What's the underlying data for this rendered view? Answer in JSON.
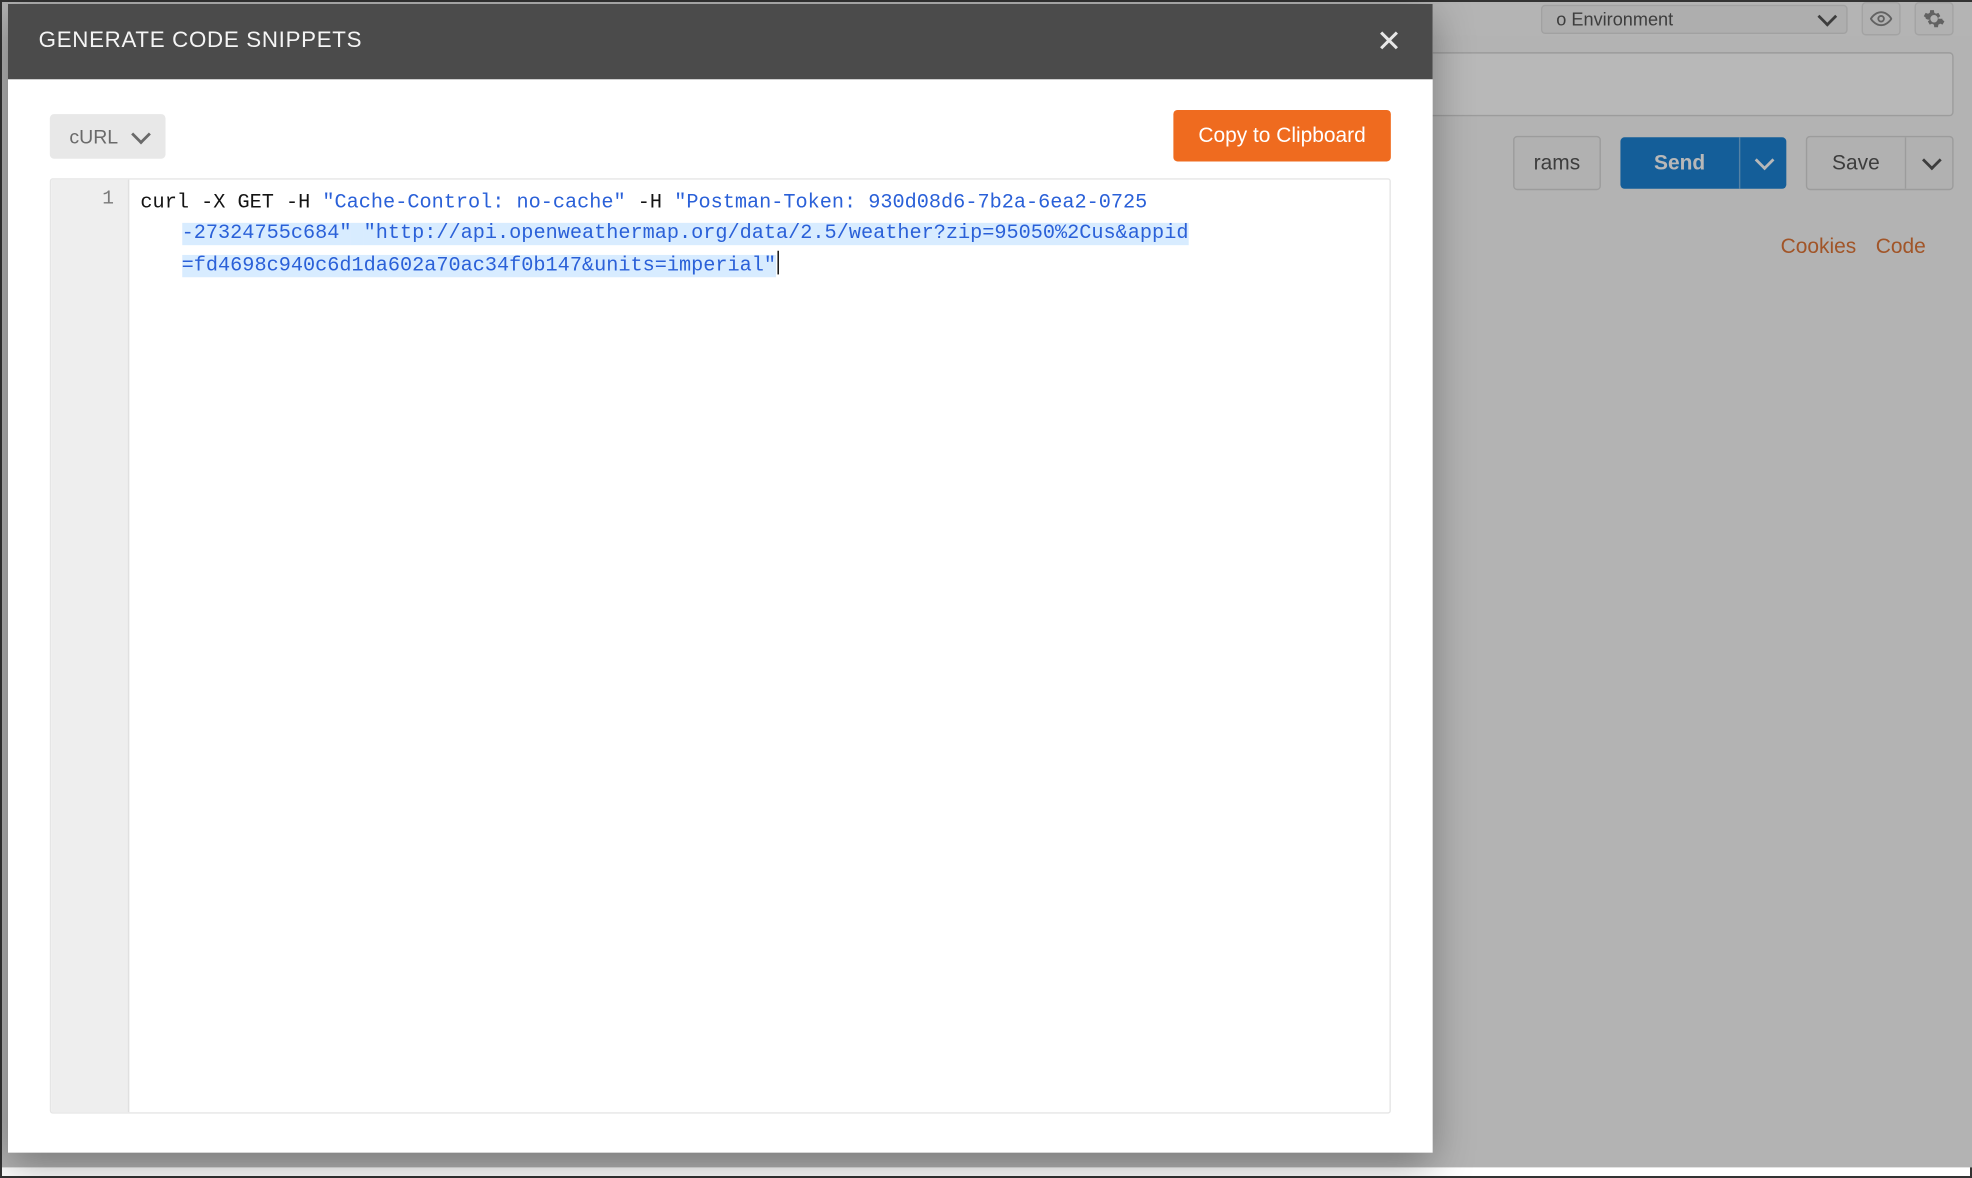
{
  "background": {
    "environment_label": "o Environment",
    "params_partial": "rams",
    "send_label": "Send",
    "save_label": "Save",
    "link_cookies": "Cookies",
    "link_code": "Code"
  },
  "modal": {
    "title": "GENERATE CODE SNIPPETS",
    "language": "cURL",
    "copy_label": "Copy to Clipboard",
    "line_number": "1",
    "code": {
      "cmd": "curl",
      "flag_x": "-X",
      "method": "GET",
      "flag_h1": "-H",
      "header1": "\"Cache-Control: no-cache\"",
      "flag_h2": "-H",
      "header2_a": "\"Postman-Token: 930d08d6-7b2a-6ea2-0725",
      "header2_b": "-27324755c684\"",
      "url_a": "\"http://api.openweathermap.org/data/2.5/weather?zip=95050%2Cus&appid",
      "url_b": "=fd4698c940c6d1da602a70ac34f0b147&units=imperial\""
    }
  }
}
